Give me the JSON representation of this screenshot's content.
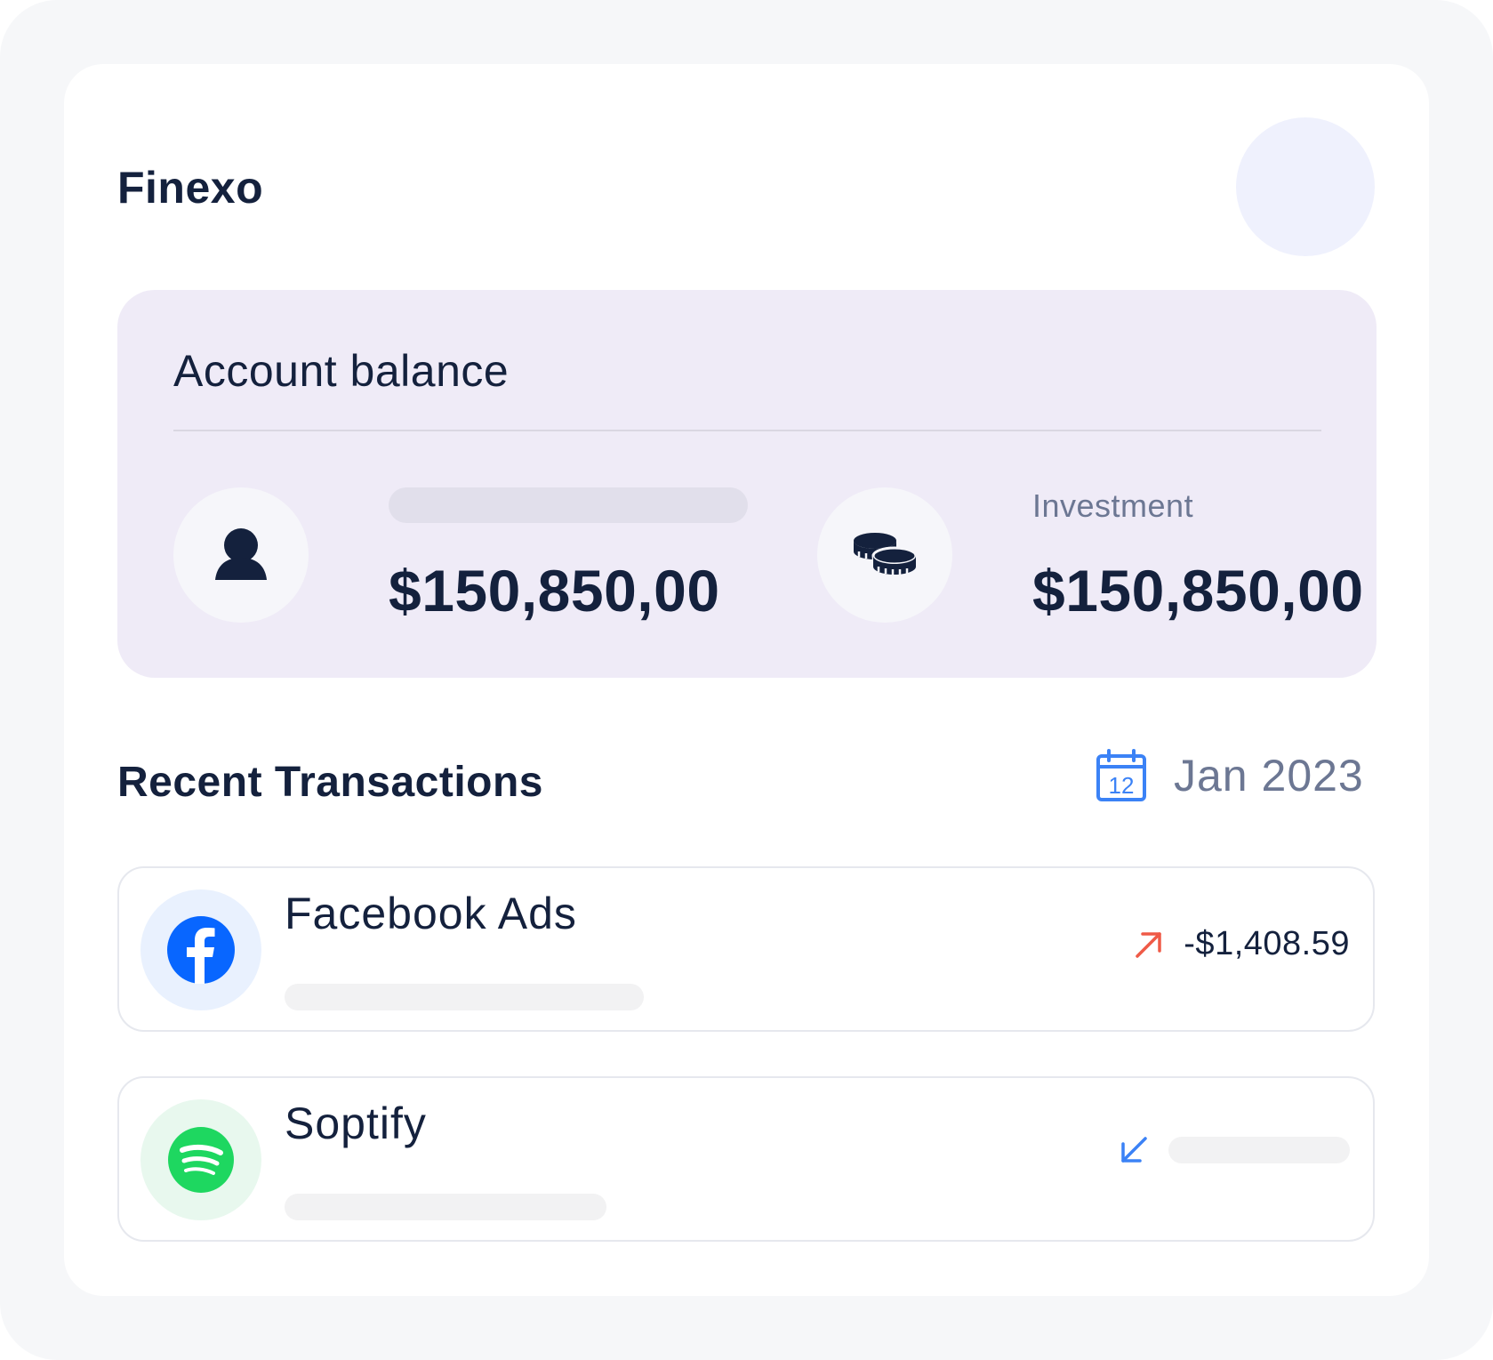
{
  "app": {
    "brand": "Finexo"
  },
  "balance": {
    "title": "Account balance",
    "personal": {
      "amount": "$150,850,00"
    },
    "investment": {
      "label": "Investment",
      "amount": "$150,850,00"
    }
  },
  "transactions": {
    "title": "Recent Transactions",
    "date": "Jan 2023",
    "calendar_day": "12",
    "items": [
      {
        "name": "Facebook Ads",
        "amount": "-$1,408.59",
        "direction": "outgoing",
        "arrow_color": "#ef5a47",
        "logo": "facebook-icon"
      },
      {
        "name": "Soptify",
        "amount": "",
        "direction": "incoming",
        "arrow_color": "#3b82f6",
        "logo": "spotify-icon"
      }
    ]
  },
  "colors": {
    "primary_text": "#14213d",
    "muted_text": "#6c7793",
    "balance_bg": "#efebf7",
    "facebook": "#0866ff",
    "spotify": "#1ed760",
    "calendar": "#3b82f6"
  }
}
